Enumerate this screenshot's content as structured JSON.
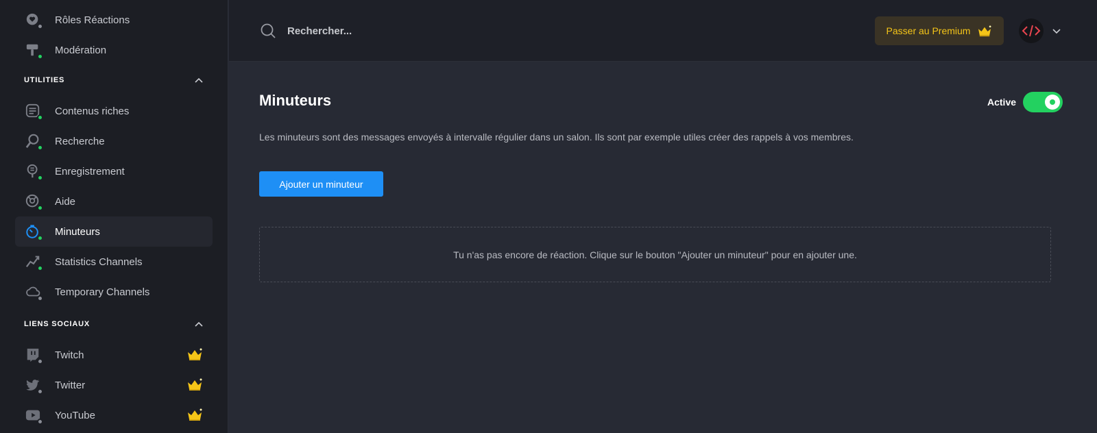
{
  "sidebar": {
    "top_items": [
      {
        "label": "Rôles Réactions",
        "icon": "role-reaction-icon",
        "status": "off"
      },
      {
        "label": "Modération",
        "icon": "hammer-icon",
        "status": "on"
      }
    ],
    "sections": [
      {
        "title": "UTILITIES",
        "items": [
          {
            "label": "Contenus riches",
            "icon": "embed-icon",
            "status": "on"
          },
          {
            "label": "Recherche",
            "icon": "search-icon",
            "status": "on"
          },
          {
            "label": "Enregistrement",
            "icon": "record-icon",
            "status": "on"
          },
          {
            "label": "Aide",
            "icon": "help-icon",
            "status": "on"
          },
          {
            "label": "Minuteurs",
            "icon": "timer-icon",
            "status": "on",
            "active": true
          },
          {
            "label": "Statistics Channels",
            "icon": "stats-icon",
            "status": "on"
          },
          {
            "label": "Temporary Channels",
            "icon": "cloud-icon",
            "status": "off"
          }
        ]
      },
      {
        "title": "LIENS SOCIAUX",
        "items": [
          {
            "label": "Twitch",
            "icon": "twitch-icon",
            "status": "off",
            "premium": true
          },
          {
            "label": "Twitter",
            "icon": "twitter-icon",
            "status": "off",
            "premium": true
          },
          {
            "label": "YouTube",
            "icon": "youtube-icon",
            "status": "off",
            "premium": true
          }
        ]
      }
    ]
  },
  "topbar": {
    "search_placeholder": "Rechercher...",
    "premium_label": "Passer au Premium"
  },
  "main": {
    "title": "Minuteurs",
    "toggle_label": "Active",
    "toggle_on": true,
    "description": "Les minuteurs sont des messages envoyés à intervalle régulier dans un salon. Ils sont par exemple utiles créer des rappels à vos membres.",
    "add_button": "Ajouter un minuteur",
    "empty_message": "Tu n'as pas encore de réaction. Clique sur le bouton \"Ajouter un minuteur\" pour en ajouter une."
  },
  "colors": {
    "accent_blue": "#1e8ff5",
    "status_green": "#23d160",
    "premium_gold": "#f5c518",
    "code_red": "#e8454f"
  }
}
